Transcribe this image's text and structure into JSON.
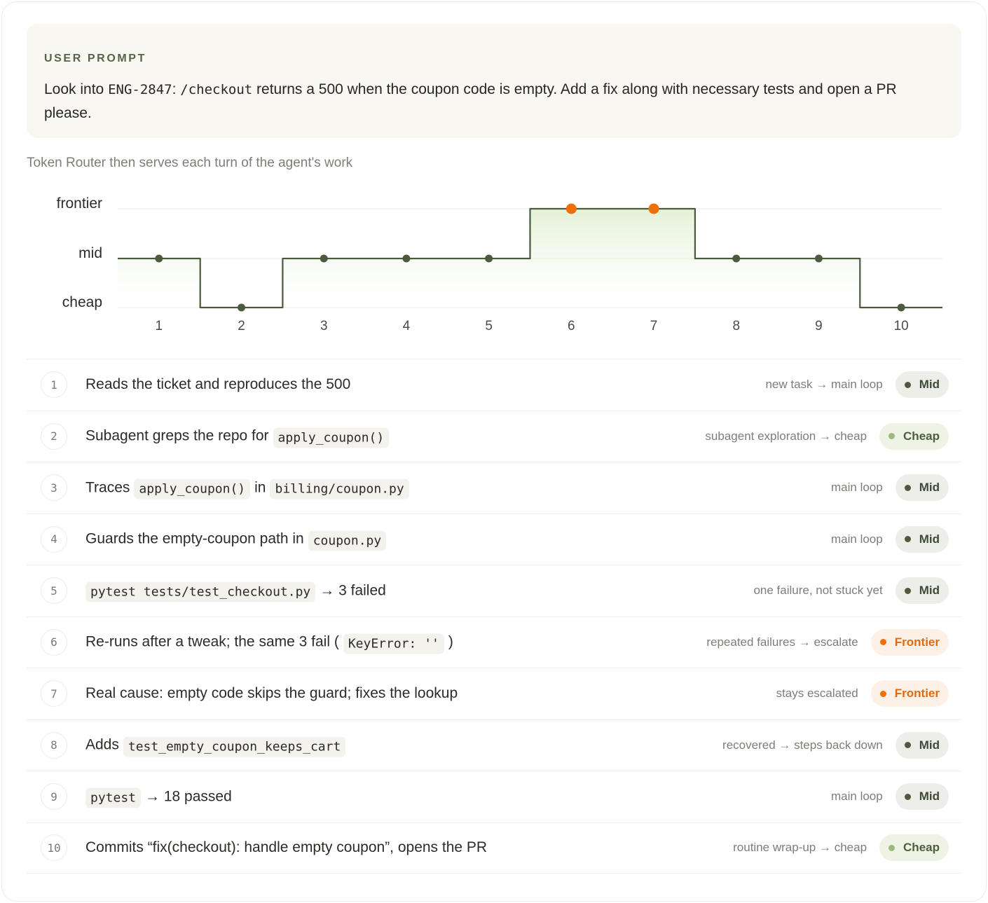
{
  "prompt": {
    "label": "USER PROMPT",
    "text_before": "Look into ",
    "ticket": "ENG-2847",
    "text_mid": ": ",
    "endpoint": "/checkout",
    "text_after": " returns a 500 when the coupon code is empty. Add a fix along with necessary tests and open a PR please."
  },
  "caption": "Token Router then serves each turn of the agent's work",
  "colors": {
    "line": "#4a5a3c",
    "mid_dot": "#4c5a40",
    "frontier_dot": "#ef6f08",
    "fill_top": "#d9ecc6",
    "grid": "#efeee9"
  },
  "chart_data": {
    "type": "line",
    "step": true,
    "levels": [
      "cheap",
      "mid",
      "frontier"
    ],
    "x": [
      1,
      2,
      3,
      4,
      5,
      6,
      7,
      8,
      9,
      10
    ],
    "x_labels": [
      "1",
      "2",
      "3",
      "4",
      "5",
      "6",
      "7",
      "8",
      "9",
      "10"
    ],
    "values": [
      "mid",
      "cheap",
      "mid",
      "mid",
      "mid",
      "frontier",
      "frontier",
      "mid",
      "mid",
      "cheap"
    ],
    "grid": true
  },
  "turns": [
    {
      "num": "1",
      "parts": [
        {
          "t": "Reads the ticket and reproduces the 500"
        }
      ],
      "reason": "new task → main loop",
      "tier": "mid",
      "tier_label": "Mid"
    },
    {
      "num": "2",
      "parts": [
        {
          "t": "Subagent greps the repo for"
        },
        {
          "c": "apply_coupon()"
        }
      ],
      "reason": "subagent exploration → cheap",
      "tier": "cheap",
      "tier_label": "Cheap"
    },
    {
      "num": "3",
      "parts": [
        {
          "t": "Traces"
        },
        {
          "c": "apply_coupon()"
        },
        {
          "t": "in"
        },
        {
          "c": "billing/coupon.py"
        }
      ],
      "reason": "main loop",
      "tier": "mid",
      "tier_label": "Mid"
    },
    {
      "num": "4",
      "parts": [
        {
          "t": "Guards the empty-coupon path in"
        },
        {
          "c": "coupon.py"
        }
      ],
      "reason": "main loop",
      "tier": "mid",
      "tier_label": "Mid"
    },
    {
      "num": "5",
      "parts": [
        {
          "c": "pytest tests/test_checkout.py"
        },
        {
          "t": "→ 3 failed"
        }
      ],
      "reason": "one failure, not stuck yet",
      "tier": "mid",
      "tier_label": "Mid"
    },
    {
      "num": "6",
      "parts": [
        {
          "t": "Re-runs after a tweak; the same 3 fail ("
        },
        {
          "c": "KeyError: ''"
        },
        {
          "t": ")"
        }
      ],
      "reason": "repeated failures → escalate",
      "tier": "frontier",
      "tier_label": "Frontier"
    },
    {
      "num": "7",
      "parts": [
        {
          "t": "Real cause: empty code skips the guard; fixes the lookup"
        }
      ],
      "reason": "stays escalated",
      "tier": "frontier",
      "tier_label": "Frontier"
    },
    {
      "num": "8",
      "parts": [
        {
          "t": "Adds"
        },
        {
          "c": "test_empty_coupon_keeps_cart"
        }
      ],
      "reason": "recovered → steps back down",
      "tier": "mid",
      "tier_label": "Mid"
    },
    {
      "num": "9",
      "parts": [
        {
          "c": "pytest"
        },
        {
          "t": "→ 18 passed"
        }
      ],
      "reason": "main loop",
      "tier": "mid",
      "tier_label": "Mid"
    },
    {
      "num": "10",
      "parts": [
        {
          "t": "Commits “fix(checkout): handle empty coupon”, opens the PR"
        }
      ],
      "reason": "routine wrap-up → cheap",
      "tier": "cheap",
      "tier_label": "Cheap"
    }
  ]
}
